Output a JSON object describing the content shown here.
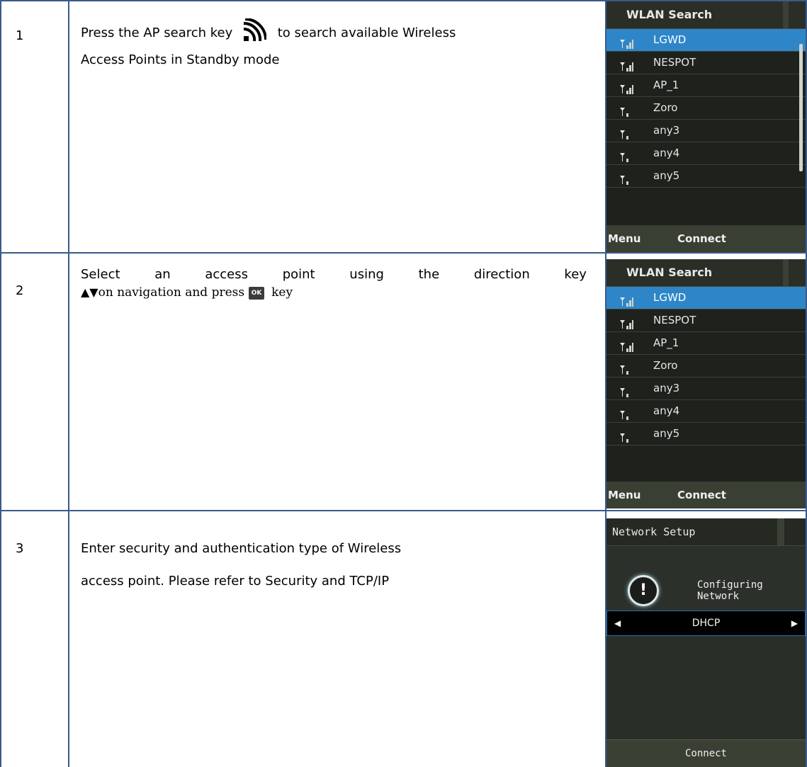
{
  "steps": [
    {
      "number": "1",
      "text_before": "Press the AP search key",
      "text_after": "to search available Wireless",
      "text_line2": "Access Points in Standby mode",
      "icon": "wifi-search-icon"
    },
    {
      "number": "2",
      "line1_words": [
        "Select",
        "an",
        "access",
        "point",
        "using",
        "the",
        "direction",
        "key"
      ],
      "line2_arrows": "▲▼",
      "line2_before": "on navigation and press",
      "line2_after": "key",
      "ok_icon_label": "OK",
      "icon": "ok-key-icon"
    },
    {
      "number": "3",
      "text_line1": "Enter security and authentication type of Wireless",
      "text_line2": "access point. Please refer to Security and TCP/IP"
    }
  ],
  "wlan_screen": {
    "title": "WLAN Search",
    "items": [
      "LGWD",
      "NESPOT",
      "AP_1",
      "Zoro",
      "any3",
      "any4",
      "any5"
    ],
    "selected_index": 0,
    "softkey_left": "Menu",
    "softkey_center": "Connect"
  },
  "network_screen": {
    "title": "Network Setup",
    "icon": "alert-icon",
    "message_line1": "Configuring",
    "message_line2": "Network",
    "option_value": "DHCP",
    "softkey_center": "Connect"
  },
  "colors": {
    "grid_line": "#3b5a8a",
    "phone_bg": "#1e211c",
    "selection": "#2e86c8",
    "footer": "#3a3f33"
  }
}
